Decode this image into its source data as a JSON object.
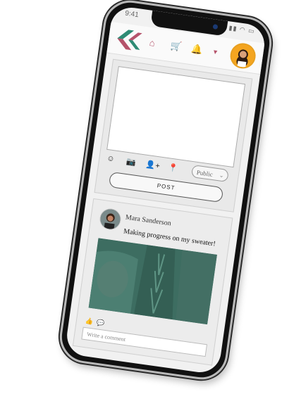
{
  "status": {
    "time": "9:41"
  },
  "composer": {
    "visibility": "Public",
    "post_label": "POST"
  },
  "post": {
    "author": "Mara Sanderson",
    "text": "Making progress on my sweater!",
    "comment_placeholder": "Write a comment"
  },
  "colors": {
    "brand_green": "#2e8b74",
    "brand_rose": "#b5536b",
    "avatar_bg": "#f4a520",
    "sweater": "#3f6f62"
  },
  "icons": [
    "home-icon",
    "cart-icon",
    "bell-icon",
    "smiley-icon",
    "camera-icon",
    "add-user-icon",
    "location-icon",
    "like-icon",
    "comment-icon"
  ]
}
